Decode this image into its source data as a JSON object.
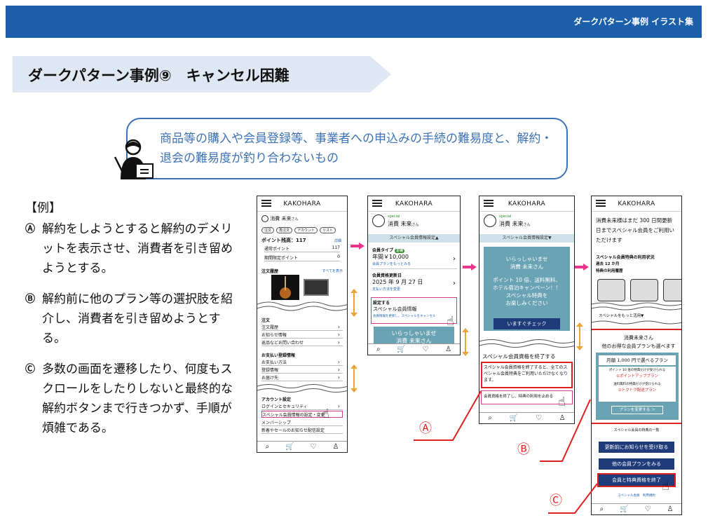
{
  "header": {
    "top_title": "ダークパターン事例 イラスト集"
  },
  "slide": {
    "title": "ダークパターン事例⑨　キャンセル困難"
  },
  "definition": {
    "text": "商品等の購入や会員登録等、事業者への申込みの手続の難易度と、解約・退会の難易度が釣り合わないもの"
  },
  "examples": {
    "label": "【例】",
    "items": [
      {
        "mark": "Ⓐ",
        "text": "解約をしようとすると解約のデメリットを表示させ、消費者を引き留めようとする。"
      },
      {
        "mark": "Ⓑ",
        "text": "解約前に他のプラン等の選択肢を紹介し、消費者を引き留めようとする。"
      },
      {
        "mark": "Ⓒ",
        "text": "多数の画面を遷移したり、何度もスクロールをしたりしないと最終的な解約ボタンまで行きつかず、手順が煩雑である。"
      }
    ]
  },
  "phone_common": {
    "brand": "KAKOHARA",
    "footer_icons": [
      "⌕",
      "🛒",
      "♡",
      "♙"
    ]
  },
  "phone1": {
    "user": "消費 未来",
    "honorific": "さん",
    "chips": [
      "注文",
      "再注文",
      "アカウント",
      "リスト"
    ],
    "points_title": "ポイント残高：117",
    "points_detail": "詳細",
    "points_rows": [
      {
        "label": "通常ポイント",
        "value": "117"
      },
      {
        "label": "期間限定ポイント",
        "value": "0"
      }
    ],
    "orders_title": "注文履歴",
    "orders_all": "すべてを表示",
    "order_section": "注文",
    "order_items": [
      "注文履歴",
      "お知らせ情報",
      "返品などお問い合わせ"
    ],
    "pay_section": "お支払い登録情報",
    "pay_items": [
      "お支払い方法",
      "登録情報",
      "お届け先"
    ],
    "account_section": "アカウント設定",
    "account_items": [
      "ログインとセキュリティ",
      "スペシャル会員情報の設定・変更",
      "メンバーシップ",
      "新着やセールのお知らせ配信設定"
    ]
  },
  "phone2": {
    "special": "special",
    "user": "消費 未来",
    "honorific": "さん",
    "section_bar": "スペシャル会員情報設定▲",
    "type_label": "会員タイプ",
    "type_badge": "お得",
    "type_price": "年間￥10,000",
    "type_link": "会員プランをもっとみる",
    "renew_label": "会員資格更新日",
    "renew_date": "2025 年 9 月 27 日",
    "renew_link": "支払い方法を変更",
    "setting_label": "設定する",
    "setting_title": "スペシャル会員情報",
    "setting_link": "会員情報を更新し、スペシャルをキャンセル",
    "welcome_top": "いらっしゃいませ",
    "welcome_sub": "消費 未来さん"
  },
  "phone3": {
    "special": "special",
    "user": "消費 未来",
    "honorific": "さん",
    "section_bar": "スペシャル会員情報設定▼",
    "welcome_lines": [
      "いらっしゃいませ",
      "消費 未来さん"
    ],
    "promo_lines": [
      "ポイント 10 倍、送料無料、",
      "ホテル宿泊キャンペーン！！",
      "スペシャル特典を",
      "お楽しみください"
    ],
    "check_button": "いますぐチェック",
    "end_title": "スペシャル会員資格を終了する",
    "end_warning": "スペシャル会員資格を終了すると、全てのスペシャル会員特典をご利用いただけなくなります。",
    "end_link": "会員資格を終了し、特典の利用を止める"
  },
  "phone4": {
    "intro": "消費未来様はまだ 300 日間更新日までスペシャル会員をご利用いただけます",
    "usage_title": "スペシャル会員特典の利用状況",
    "usage_period": "過去 12 か月",
    "usage_history": "特典の利用履歴",
    "more_link": "スペシャルをもっと活用▼",
    "offer_name": "消費未来さん",
    "offer_title": "他のお得な会員プランも選べます",
    "plan_title": "月額 1,000 円で選べるプラン",
    "plan1_desc": "ポイント 10 倍の特典だけが受けられる",
    "plan1_name": "①ポイントアッププラン",
    "plan2_desc": "送料無料の特典だけが受けられる",
    "plan2_name": "②トクトク配送プラン",
    "change_button": "プランを変更する ＞",
    "list_title": "スペシャル会員の特典の一覧",
    "btn_notice": "更新前にお知らせを受け取る",
    "btn_other": "他の会員プランをみる",
    "btn_end": "会員と特典資格を終了",
    "foot_links": "スペシャル会員　利用規約"
  },
  "callouts": {
    "a": "Ⓐ",
    "b": "Ⓑ",
    "c": "Ⓒ"
  },
  "colors": {
    "header_blue": "#1b5faa",
    "definition_blue": "#3d73b5",
    "highlight_red": "#e0201e",
    "arrow_pink": "#e8338a",
    "teal": "#6aa3b4",
    "navy": "#1f3b7a"
  }
}
